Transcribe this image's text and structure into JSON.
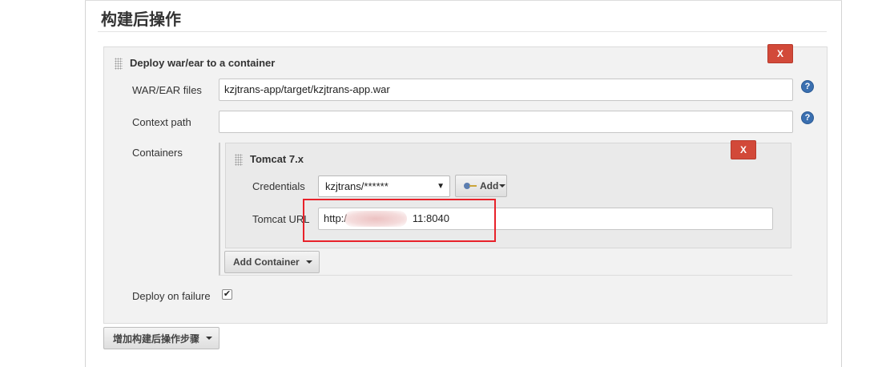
{
  "section": {
    "title": "构建后操作"
  },
  "deploy_step": {
    "title": "Deploy war/ear to a container",
    "delete_label": "X",
    "war_ear_files": {
      "label": "WAR/EAR files",
      "value": "kzjtrans-app/target/kzjtrans-app.war"
    },
    "context_path": {
      "label": "Context path",
      "value": ""
    },
    "containers_label": "Containers",
    "help_label": "?",
    "tomcat": {
      "title": "Tomcat 7.x",
      "delete_label": "X",
      "credentials": {
        "label": "Credentials",
        "selected": "kzjtrans/******",
        "caret": "▼"
      },
      "add_button_label": "Add",
      "url": {
        "label": "Tomcat URL",
        "value_prefix": "http:/",
        "value_suffix": "11:8040"
      }
    },
    "add_container_label": "Add Container",
    "deploy_on_failure": {
      "label": "Deploy on failure",
      "checked_mark": "✔"
    }
  },
  "add_post_build_step_label": "增加构建后操作步骤",
  "colors": {
    "delete_red": "#d24939",
    "highlight_red": "#e8222a",
    "help_blue": "#3a6fb0"
  }
}
